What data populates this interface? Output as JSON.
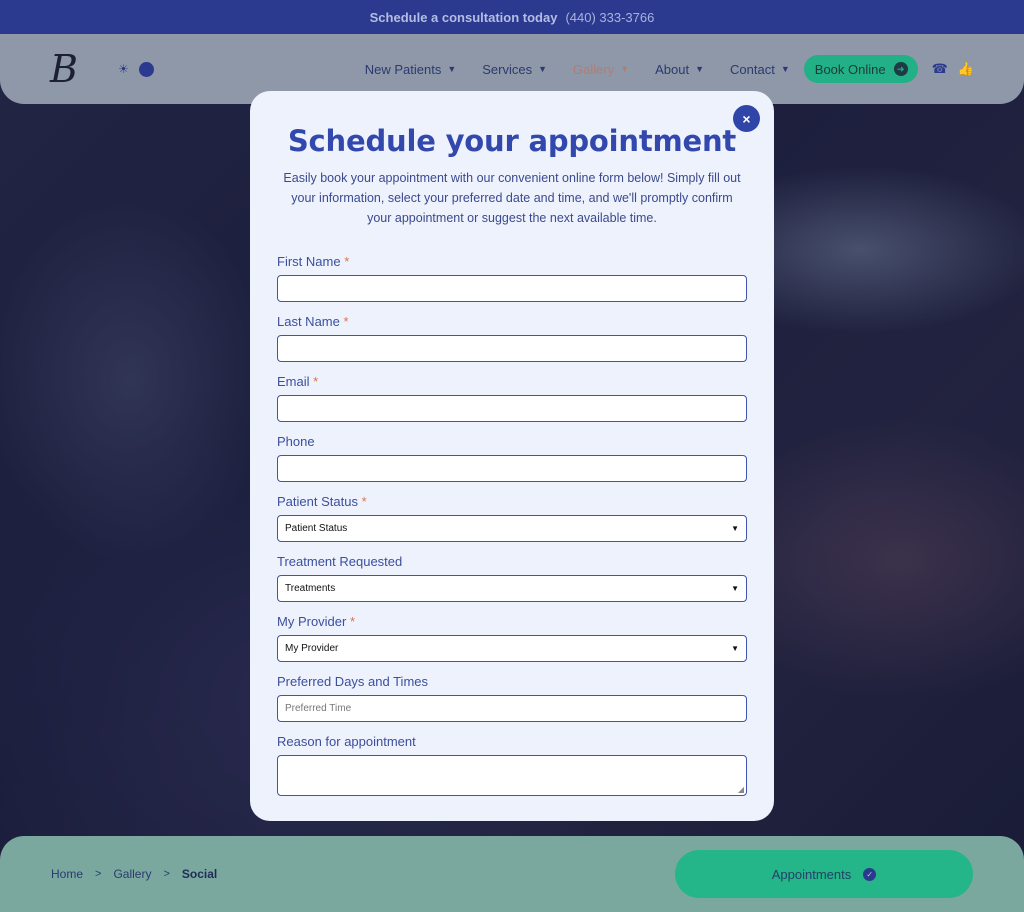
{
  "topbar": {
    "cta": "Schedule a consultation today",
    "phone": "(440) 333-3766"
  },
  "header": {
    "logo": "B",
    "nav": [
      {
        "label": "New Patients"
      },
      {
        "label": "Services"
      },
      {
        "label": "Gallery"
      },
      {
        "label": "About"
      },
      {
        "label": "Contact"
      }
    ],
    "book_label": "Book Online"
  },
  "modal": {
    "title": "Schedule your appointment",
    "intro": "Easily book your appointment with our convenient online form below! Simply fill out your information, select your preferred date and time, and we'll promptly confirm your appointment or suggest the next available time.",
    "fields": {
      "first_name": {
        "label": "First Name",
        "required_mark": "*"
      },
      "last_name": {
        "label": "Last Name",
        "required_mark": "*"
      },
      "email": {
        "label": "Email",
        "required_mark": "*"
      },
      "phone": {
        "label": "Phone"
      },
      "patient_status": {
        "label": "Patient Status",
        "required_mark": "*",
        "value": "Patient Status"
      },
      "treatment": {
        "label": "Treatment Requested",
        "value": "Treatments"
      },
      "provider": {
        "label": "My Provider",
        "required_mark": "*",
        "value": "My Provider"
      },
      "preferred": {
        "label": "Preferred Days and Times",
        "placeholder": "Preferred Time"
      },
      "reason": {
        "label": "Reason for appointment"
      }
    },
    "close_icon": "×"
  },
  "footer": {
    "breadcrumb": [
      "Home",
      "Gallery",
      "Social"
    ],
    "separator": ">",
    "appointments_label": "Appointments"
  },
  "colors": {
    "accent": "#3348ad",
    "green": "#22b087",
    "required": "#e0704a"
  }
}
